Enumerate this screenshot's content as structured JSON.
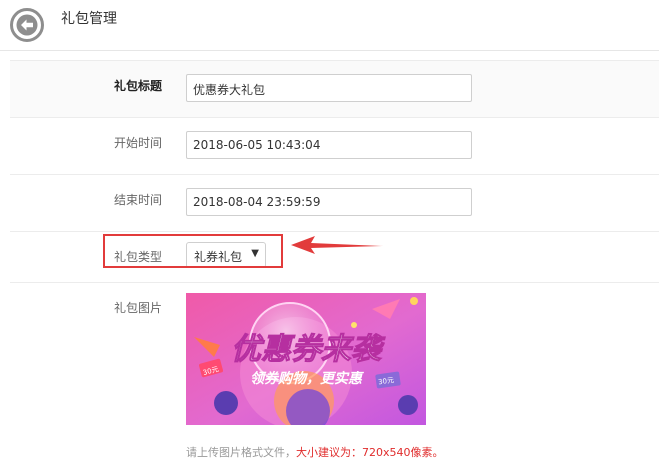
{
  "header": {
    "title": "礼包管理"
  },
  "form": {
    "title_label": "礼包标题",
    "title_value": "优惠券大礼包",
    "start_label": "开始时间",
    "start_value": "2018-06-05 10:43:04",
    "end_label": "结束时间",
    "end_value": "2018-08-04 23:59:59",
    "type_label": "礼包类型",
    "type_value": "礼券礼包",
    "image_label": "礼包图片"
  },
  "banner": {
    "headline": "优惠券来袭",
    "subline": "领券购物，更实惠",
    "tag_left": "30元",
    "tag_right": "30元"
  },
  "hint": {
    "prefix": "请上传图片格式文件，",
    "emphasis": "大小建议为：720x540像素。"
  },
  "colors": {
    "highlight": "#e23b3b",
    "hint_red": "#e02c2c"
  }
}
